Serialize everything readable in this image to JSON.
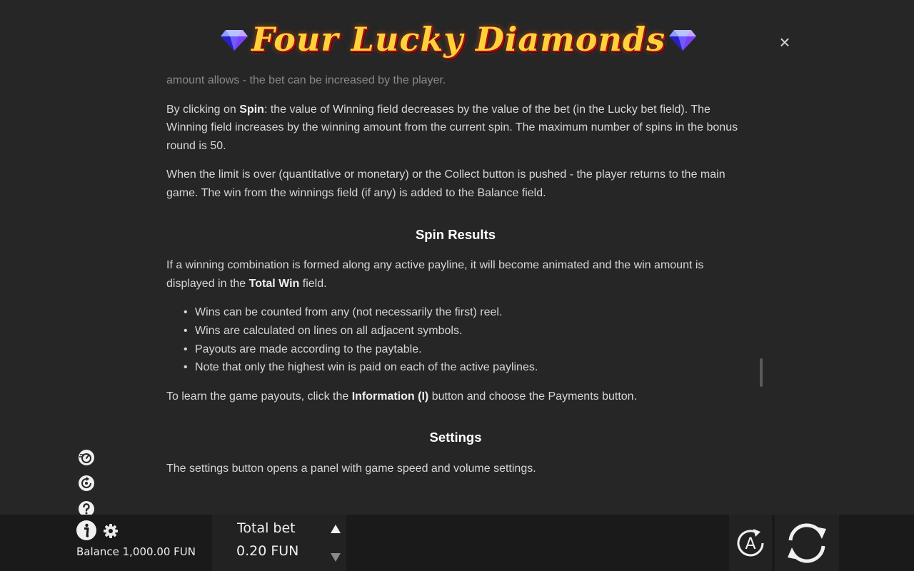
{
  "header": {
    "logo_text": "Four Lucky Diamonds",
    "close_label": "×"
  },
  "content": {
    "faded_line": "amount allows - the bet can be increased by the player.",
    "para_spin": {
      "prefix": "By clicking on ",
      "bold": "Spin",
      "suffix": ": the value of Winning field decreases by the value of the bet (in the Lucky bet field). The Winning field increases by the winning amount from the current spin. The maximum number of spins in the bonus round is 50."
    },
    "para_limit": "When the limit is over (quantitative or monetary) or the Collect button is pushed - the player returns to the main game. The win from the winnings field (if any) is added to the Balance field.",
    "spin_results_title": "Spin Results",
    "para_winning": {
      "prefix": "If a winning combination is formed along any active payline, it will become animated and the win amount is displayed in the ",
      "bold": "Total Win",
      "suffix": " field."
    },
    "bullets": [
      "Wins can be counted from any (not necessarily the first) reel.",
      "Wins are calculated on lines on all adjacent symbols.",
      "Payouts are made according to the paytable.",
      "Note that only the highest win is paid on each of the active paylines."
    ],
    "para_payouts": {
      "prefix": "To learn the game payouts, click the ",
      "bold": "Information (I)",
      "suffix": " button and choose the Payments button."
    },
    "settings_title": "Settings",
    "para_settings": "The settings button opens a panel with game speed and volume settings."
  },
  "bottom_bar": {
    "balance_label": "Balance",
    "balance_value": "1,000.00 FUN",
    "total_bet_label": "Total bet",
    "total_bet_value": "0.20 FUN",
    "auto_label": "A"
  },
  "icons": {
    "side": [
      "turbo-icon",
      "quick-spin-icon",
      "help-icon"
    ],
    "info": "info-icon",
    "settings": "gear-icon",
    "spin": "spin-icon"
  },
  "colors": {
    "background": "#262626",
    "bottom_bar": "#1a1a1a",
    "logo_gold": "#ffd23a",
    "logo_red": "#b0101a"
  }
}
